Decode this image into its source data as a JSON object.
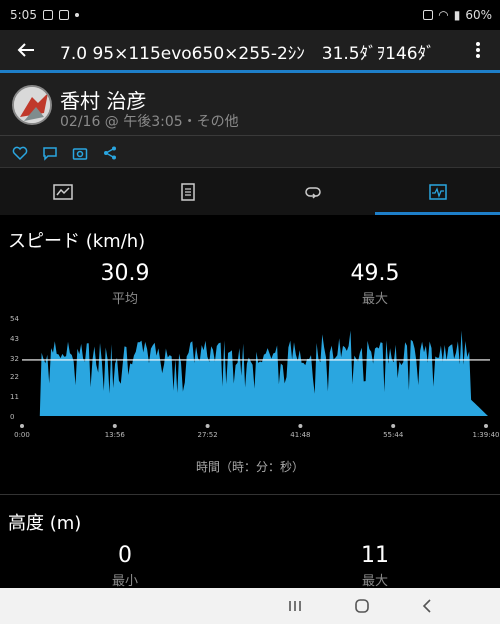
{
  "status_bar": {
    "time": "5:05",
    "battery": "60%"
  },
  "app_bar": {
    "title": "7.0 95×115evo650×255-2ｼﾝ　31.5ﾀﾞｦ146ﾀﾞ"
  },
  "header": {
    "user_name": "香村 治彦",
    "activity_meta": "02/16 @ 午後3:05・その他"
  },
  "tabs": [
    {
      "icon": "summary-icon",
      "active": false
    },
    {
      "icon": "laps-icon",
      "active": false
    },
    {
      "icon": "segment-icon",
      "active": false
    },
    {
      "icon": "chart-icon",
      "active": true
    }
  ],
  "speed": {
    "title": "スピード (km/h)",
    "avg_value": "30.9",
    "avg_label": "平均",
    "max_value": "49.5",
    "max_label": "最大"
  },
  "chart_data": {
    "type": "area",
    "ylabel_ticks": [
      "54",
      "43",
      "32",
      "22",
      "11",
      "0"
    ],
    "x_ticks": [
      "0:00",
      "13:56",
      "27:52",
      "41:48",
      "55:44",
      "1:39:40"
    ],
    "xlabel": "時間（時：分：秒）",
    "ylim": [
      0,
      54
    ],
    "avg_line": 30.9,
    "color": "#2aa6e0"
  },
  "altitude": {
    "title": "高度 (m)",
    "min_value": "0",
    "min_label": "最小",
    "max_value": "11",
    "max_label": "最大"
  }
}
